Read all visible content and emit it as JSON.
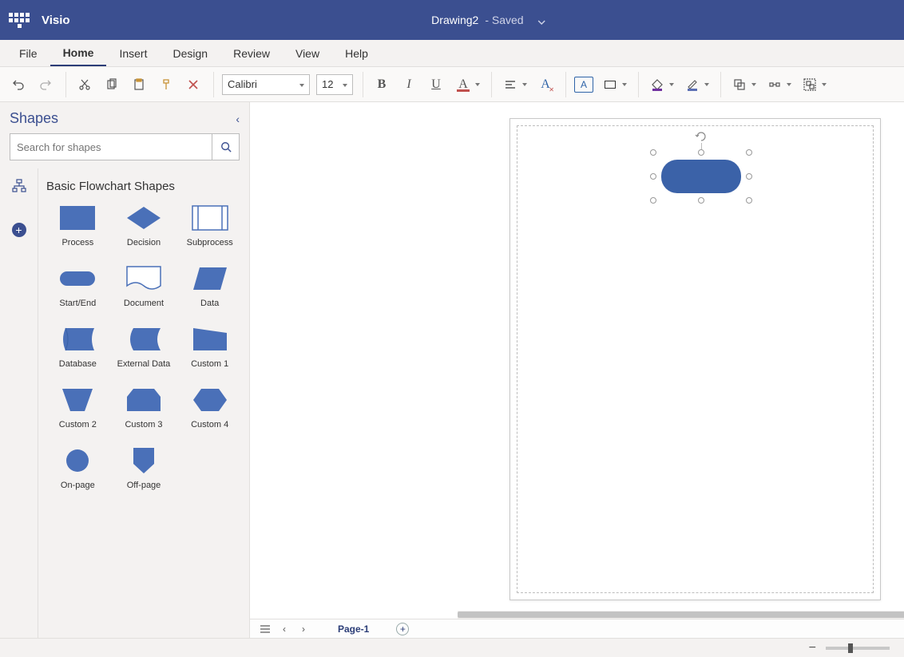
{
  "app": {
    "name": "Visio"
  },
  "document": {
    "name": "Drawing2",
    "status": "Saved"
  },
  "ribbon_tabs": {
    "file": "File",
    "home": "Home",
    "insert": "Insert",
    "design": "Design",
    "review": "Review",
    "view": "View",
    "help": "Help",
    "active": "Home"
  },
  "ribbon": {
    "font_name": "Calibri",
    "font_size": "12",
    "font_color": "#c0504d",
    "outline_color": "#000000",
    "fill_color": "#7030a0",
    "line_color": "#5b6fb4"
  },
  "shapes_panel": {
    "title": "Shapes",
    "search_placeholder": "Search for shapes",
    "library_title": "Basic Flowchart Shapes",
    "shapes": [
      {
        "id": "process",
        "label": "Process"
      },
      {
        "id": "decision",
        "label": "Decision"
      },
      {
        "id": "subprocess",
        "label": "Subprocess"
      },
      {
        "id": "startend",
        "label": "Start/End"
      },
      {
        "id": "document",
        "label": "Document"
      },
      {
        "id": "data",
        "label": "Data"
      },
      {
        "id": "database",
        "label": "Database"
      },
      {
        "id": "externaldata",
        "label": "External Data"
      },
      {
        "id": "custom1",
        "label": "Custom 1"
      },
      {
        "id": "custom2",
        "label": "Custom 2"
      },
      {
        "id": "custom3",
        "label": "Custom 3"
      },
      {
        "id": "custom4",
        "label": "Custom 4"
      },
      {
        "id": "onpage",
        "label": "On-page"
      },
      {
        "id": "offpage",
        "label": "Off-page"
      }
    ]
  },
  "canvas": {
    "selected_shape": {
      "type": "startend",
      "color": "#3b62a8"
    }
  },
  "page_tabs": {
    "current": "Page-1"
  },
  "colors": {
    "brand": "#3b4f90",
    "shape_fill": "#4a70b8",
    "shape_fill_light": "#fff",
    "shape_stroke": "#355a9b"
  }
}
